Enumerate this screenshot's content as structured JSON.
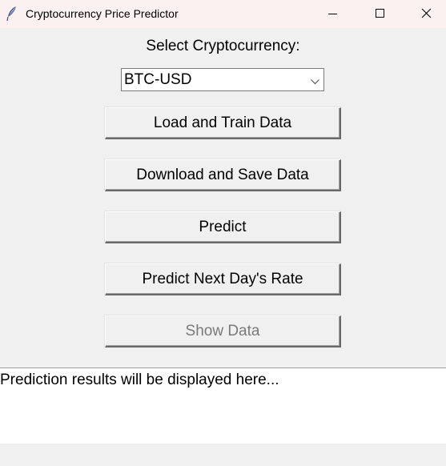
{
  "window": {
    "title": "Cryptocurrency Price Predictor",
    "app_icon": "feather-icon",
    "controls": {
      "minimize_icon": "minimize-icon",
      "maximize_icon": "maximize-icon",
      "close_icon": "close-icon"
    }
  },
  "main": {
    "select_label": "Select Cryptocurrency:",
    "crypto_select": {
      "value": "BTC-USD",
      "arrow_icon": "chevron-down-icon"
    },
    "buttons": [
      {
        "label": "Load and Train Data",
        "enabled": true
      },
      {
        "label": "Download and Save Data",
        "enabled": true
      },
      {
        "label": "Predict",
        "enabled": true
      },
      {
        "label": "Predict Next Day's Rate",
        "enabled": true
      },
      {
        "label": "Show Data",
        "enabled": false
      }
    ],
    "results_text": "Prediction results will be displayed here..."
  },
  "colors": {
    "titlebar_bg": "#fbf1f1",
    "window_bg": "#f0f0f0",
    "disabled_text": "#7a7a7a",
    "results_bg": "#ffffff"
  }
}
